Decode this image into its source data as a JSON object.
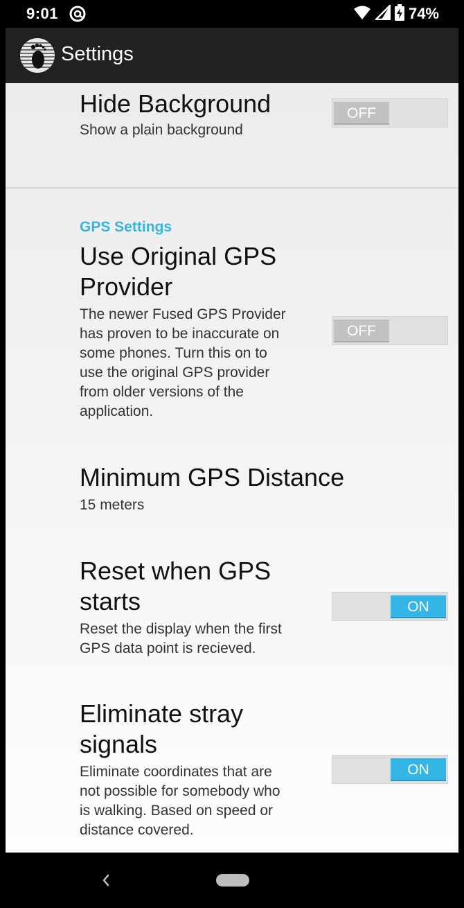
{
  "status_bar": {
    "time": "9:01",
    "battery_percent": "74%",
    "icons": [
      "at-sign-icon",
      "wifi-icon",
      "cell-signal-icon",
      "battery-charging-icon"
    ]
  },
  "action_bar": {
    "title": "Settings",
    "logo_icon": "footprint-logo-icon"
  },
  "preferences": {
    "hide_background": {
      "title": "Hide Background",
      "summary": "Show a plain background",
      "toggle": "OFF"
    },
    "gps_category": "GPS Settings",
    "original_gps": {
      "title_line1": "Use Original GPS",
      "title_line2": "Provider",
      "summary_lines": [
        "The newer Fused GPS Provider",
        "has proven to be inaccurate on",
        "some phones. Turn this on to",
        "use the original GPS provider",
        "from older versions of the",
        "application."
      ],
      "toggle": "OFF"
    },
    "min_distance": {
      "title": "Minimum GPS Distance",
      "summary": "15 meters"
    },
    "reset_gps": {
      "title_line1": "Reset when GPS",
      "title_line2": "starts",
      "summary_lines": [
        "Reset the display when the first",
        "GPS data point is recieved."
      ],
      "toggle": "ON"
    },
    "eliminate_stray": {
      "title_line1": "Eliminate stray",
      "title_line2": "signals",
      "summary_lines": [
        "Eliminate coordinates that are",
        "not possible for somebody who",
        "is walking. Based on speed or",
        "distance covered."
      ],
      "toggle": "ON"
    }
  },
  "colors": {
    "accent": "#33b5e5",
    "action_bar": "#212121",
    "toggle_off_thumb": "#c2c2c2"
  },
  "nav_bar": {
    "icons": [
      "back-icon",
      "home-pill-icon"
    ]
  }
}
